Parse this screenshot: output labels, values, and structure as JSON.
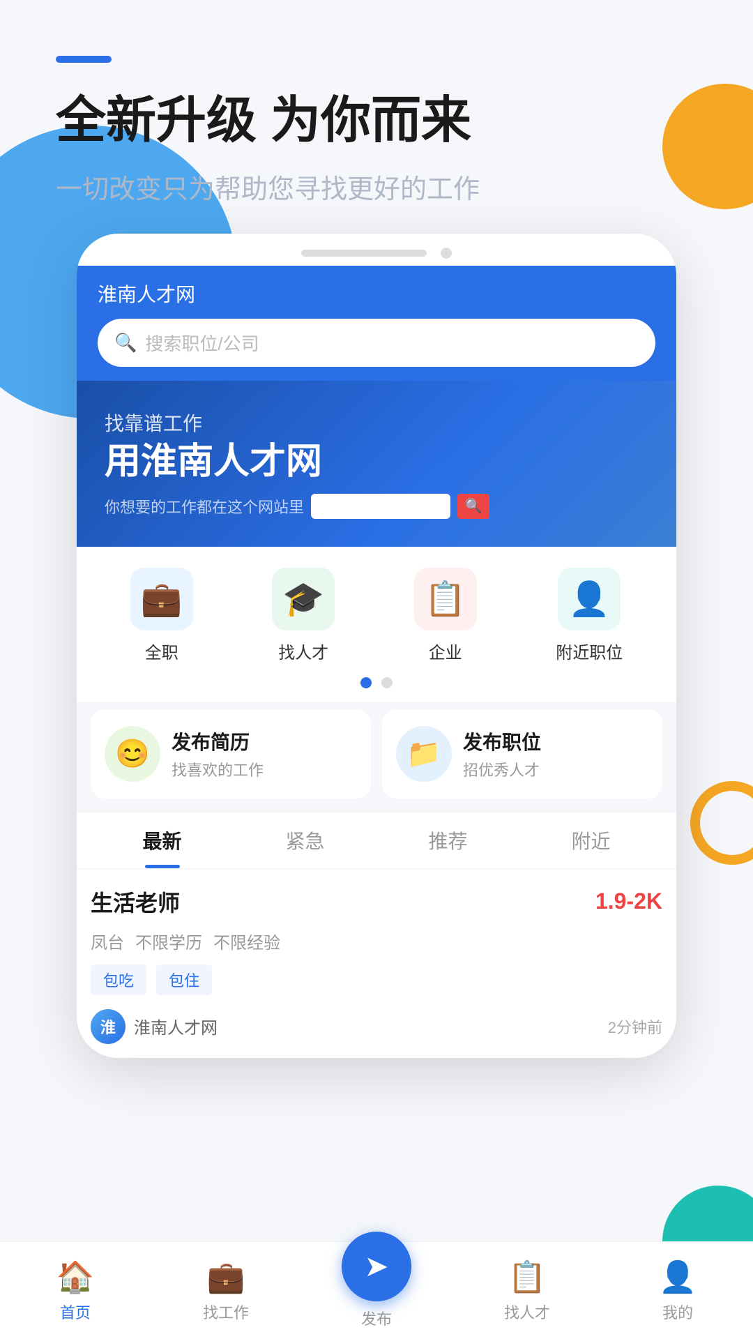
{
  "header": {
    "dash": "",
    "title": "全新升级 为你而来",
    "subtitle": "一切改变只为帮助您寻找更好的工作"
  },
  "app": {
    "name": "淮南人才网",
    "search_placeholder": "搜索职位/公司"
  },
  "banner": {
    "line1": "找靠谱工作",
    "line2": "用淮南人才网",
    "tagline": "你想要的工作都在这个网站里"
  },
  "categories": [
    {
      "label": "全职",
      "color": "#4DA8F0",
      "icon": "💼"
    },
    {
      "label": "找人才",
      "color": "#4CAF70",
      "icon": "🎓"
    },
    {
      "label": "企业",
      "color": "#E85555",
      "icon": "📋"
    },
    {
      "label": "附近职位",
      "color": "#1CBFB0",
      "icon": "👤"
    }
  ],
  "action_cards": [
    {
      "icon": "😊",
      "icon_bg": "#6DC849",
      "title": "发布简历",
      "subtitle": "找喜欢的工作"
    },
    {
      "icon": "📁",
      "icon_bg": "#2B9FE6",
      "title": "发布职位",
      "subtitle": "招优秀人才"
    }
  ],
  "tabs": [
    {
      "label": "最新",
      "active": true
    },
    {
      "label": "紧急",
      "active": false
    },
    {
      "label": "推荐",
      "active": false
    },
    {
      "label": "附近",
      "active": false
    }
  ],
  "job": {
    "title": "生活老师",
    "salary": "1.9-2K",
    "tags": [
      "凤台",
      "不限学历",
      "不限经验"
    ],
    "benefits": [
      "包吃",
      "包住"
    ],
    "company": "淮南人才网",
    "post_time": "2分钟前"
  },
  "bottom_nav": [
    {
      "label": "首页",
      "icon": "🏠",
      "active": true
    },
    {
      "label": "找工作",
      "icon": "💼",
      "active": false
    },
    {
      "label": "发布",
      "icon": "➤",
      "active": false,
      "is_publish": true
    },
    {
      "label": "找人才",
      "icon": "📋",
      "active": false
    },
    {
      "label": "我的",
      "icon": "👤",
      "active": false
    }
  ]
}
